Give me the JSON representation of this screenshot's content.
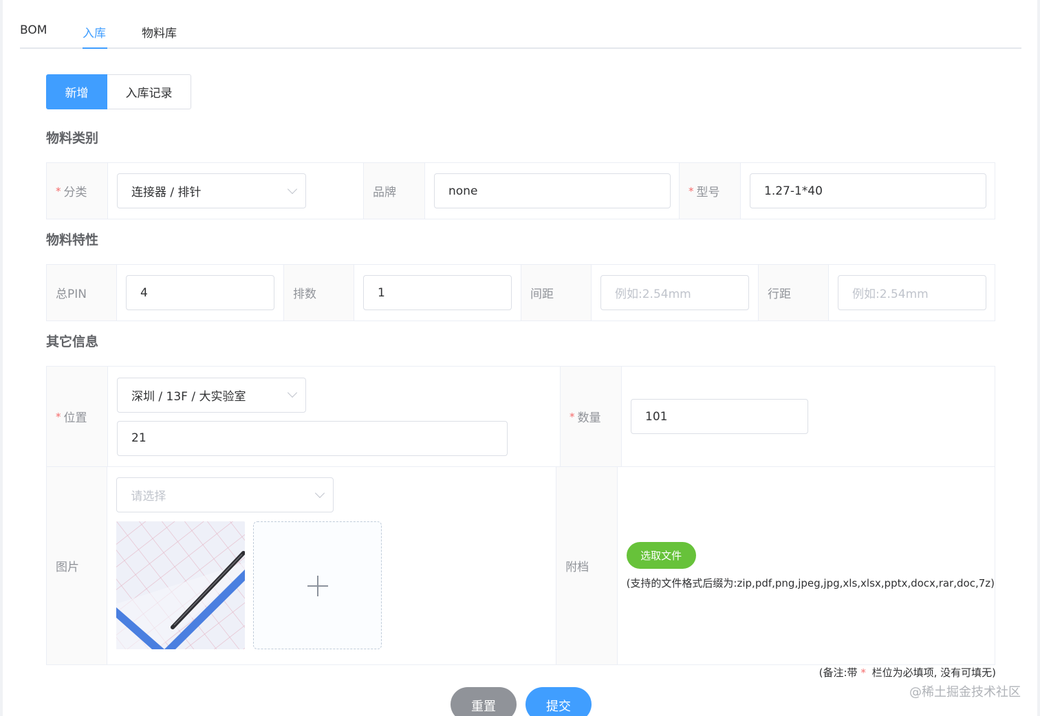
{
  "tabs": [
    {
      "label": "BOM",
      "active": false
    },
    {
      "label": "入库",
      "active": true
    },
    {
      "label": "物料库",
      "active": false
    }
  ],
  "buttons": {
    "new": "新增",
    "records": "入库记录",
    "reset": "重置",
    "submit": "提交",
    "choose_file": "选取文件"
  },
  "sections": {
    "category": "物料类别",
    "traits": "物料特性",
    "other": "其它信息"
  },
  "category": {
    "classify_label": "分类",
    "classify_value": "连接器 / 排针",
    "brand_label": "品牌",
    "brand_value": "none",
    "model_label": "型号",
    "model_value": "1.27-1*40"
  },
  "traits": {
    "pin_label": "总PIN",
    "pin_value": "4",
    "rows_label": "排数",
    "rows_value": "1",
    "pitch_label": "间距",
    "pitch_placeholder": "例如:2.54mm",
    "row_pitch_label": "行距",
    "row_pitch_placeholder": "例如:2.54mm"
  },
  "other": {
    "location_label": "位置",
    "location_value": "深圳 / 13F / 大实验室",
    "location_detail": "21",
    "quantity_label": "数量",
    "quantity_value": "101",
    "image_label": "图片",
    "image_select_placeholder": "请选择",
    "attachment_label": "附档",
    "attachment_hint": "(支持的文件格式后缀为:zip,pdf,png,jpeg,jpg,xls,xlsx,pptx,docx,rar,doc,7z)"
  },
  "required_mark": "*",
  "note": {
    "prefix": "(备注:带",
    "suffix": "栏位为必填项, 没有可填无)"
  },
  "watermark": "@稀土掘金技术社区",
  "colors": {
    "primary": "#409eff",
    "success": "#67c23a",
    "danger": "#f56c6c",
    "info": "#909399"
  }
}
